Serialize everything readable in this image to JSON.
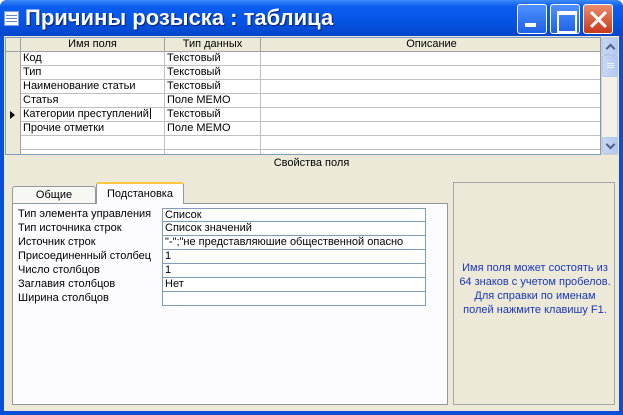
{
  "window": {
    "title": "Причины розыска : таблица",
    "icon": "table-icon",
    "controls": [
      "minimize-icon",
      "maximize-icon",
      "close-icon"
    ]
  },
  "grid": {
    "columns": [
      "Имя поля",
      "Тип данных",
      "Описание"
    ],
    "rows": [
      {
        "name": "Код",
        "type": "Текстовый",
        "description": ""
      },
      {
        "name": "Тип",
        "type": "Текстовый",
        "description": ""
      },
      {
        "name": "Наименование статьи",
        "type": "Текстовый",
        "description": ""
      },
      {
        "name": "Статья",
        "type": "Поле МЕМО",
        "description": ""
      },
      {
        "name": "Категории преступлений",
        "type": "Текстовый",
        "description": "",
        "current": true
      },
      {
        "name": "Прочие отметки",
        "type": "Поле МЕМО",
        "description": ""
      },
      {
        "name": "",
        "type": "",
        "description": ""
      },
      {
        "name": "",
        "type": "",
        "description": ""
      }
    ]
  },
  "properties": {
    "section_label": "Свойства поля",
    "tabs": [
      "Общие",
      "Подстановка"
    ],
    "active_tab": "Подстановка",
    "rows": [
      {
        "label": "Тип элемента управления",
        "value": "Список"
      },
      {
        "label": "Тип источника строк",
        "value": "Список значений"
      },
      {
        "label": "Источник строк",
        "value": "\"-\";\"не представляюшие общественной опасно"
      },
      {
        "label": "Присоединенный столбец",
        "value": "1"
      },
      {
        "label": "Число столбцов",
        "value": "1"
      },
      {
        "label": "Заглавия столбцов",
        "value": "Нет"
      },
      {
        "label": "Ширина столбцов",
        "value": ""
      }
    ]
  },
  "help": {
    "text": "Имя поля может состоять из 64 знаков с учетом пробелов.  Для справки по именам полей нажмите клавишу F1."
  },
  "colors": {
    "titlebar": "#0654e4",
    "help_text": "#1a37b8",
    "tab_highlight": "#ffc83c"
  }
}
